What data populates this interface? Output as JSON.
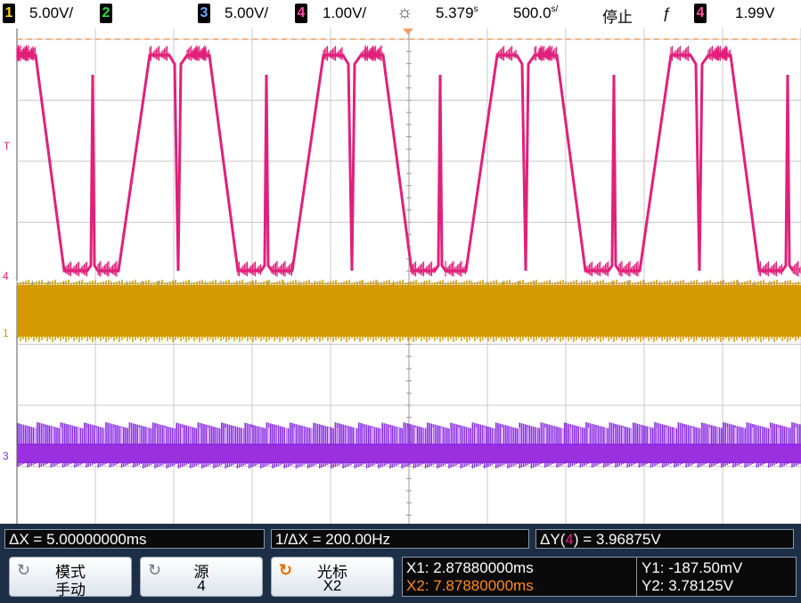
{
  "topbar": {
    "ch1_label": "1",
    "ch1_scale": "5.00V/",
    "ch2_label": "2",
    "ch3_label": "3",
    "ch3_scale": "5.00V/",
    "ch4_label": "4",
    "ch4_scale": "1.00V/",
    "time_pos": "5.379",
    "time_pos_unit": "s",
    "time_scale": "500.0",
    "time_scale_unit": "s/",
    "run_state": "停止",
    "trigger_source": "4",
    "trigger_level": "1.99V"
  },
  "markers": {
    "trigger": "T",
    "ch4": "4",
    "ch1": "1",
    "ch3": "3"
  },
  "measurements": {
    "delta_x": "ΔX = 5.00000000ms",
    "inv_delta_x": "1/ΔX = 200.00Hz",
    "delta_y_prefix": "ΔY(",
    "delta_y_ch": "4",
    "delta_y_suffix": ") = 3.96875V"
  },
  "softkeys": {
    "mode_title": "模式",
    "mode_value": "手动",
    "source_title": "源",
    "source_value": "4",
    "cursor_title": "光标",
    "cursor_value": "X2"
  },
  "cursors": {
    "x1": "X1: 2.87880000ms",
    "x2": "X2: 7.87880000ms",
    "y1": "Y1: -187.50mV",
    "y2": "Y2: 3.78125V"
  },
  "colors": {
    "ch1": "#e0a800",
    "ch2": "#22cc44",
    "ch3": "#8a2be2",
    "ch4": "#e0207a",
    "x2_cursor": "#ff8c1a"
  }
}
